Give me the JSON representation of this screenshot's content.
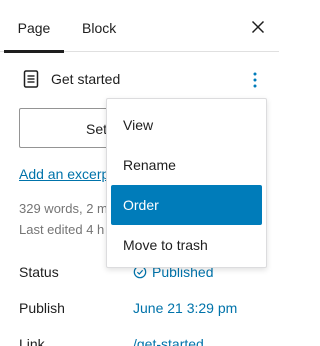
{
  "header": {
    "tabs": [
      {
        "label": "Page",
        "active": true
      },
      {
        "label": "Block",
        "active": false
      }
    ],
    "close_icon": "close-icon"
  },
  "document": {
    "icon": "page-icon",
    "title": "Get started",
    "more_icon": "vertical-ellipsis-icon"
  },
  "featured_image": {
    "label": "Set"
  },
  "excerpt": {
    "label": "Add an excerp"
  },
  "meta": {
    "line1": "329 words, 2 m",
    "line2": "Last edited 4 h"
  },
  "properties": {
    "status": {
      "label": "Status",
      "value": "Published",
      "icon": "check-circle-icon"
    },
    "publish": {
      "label": "Publish",
      "value": "June 21 3:29 pm"
    },
    "link": {
      "label": "Link",
      "value": "/get-started"
    }
  },
  "menu": {
    "items": [
      {
        "label": "View"
      },
      {
        "label": "Rename"
      },
      {
        "label": "Order"
      },
      {
        "label": "Move to trash"
      }
    ],
    "active_index": 2
  },
  "colors": {
    "accent": "#007cba",
    "link": "#0073aa",
    "text": "#1e1e1e",
    "muted": "#757575"
  }
}
